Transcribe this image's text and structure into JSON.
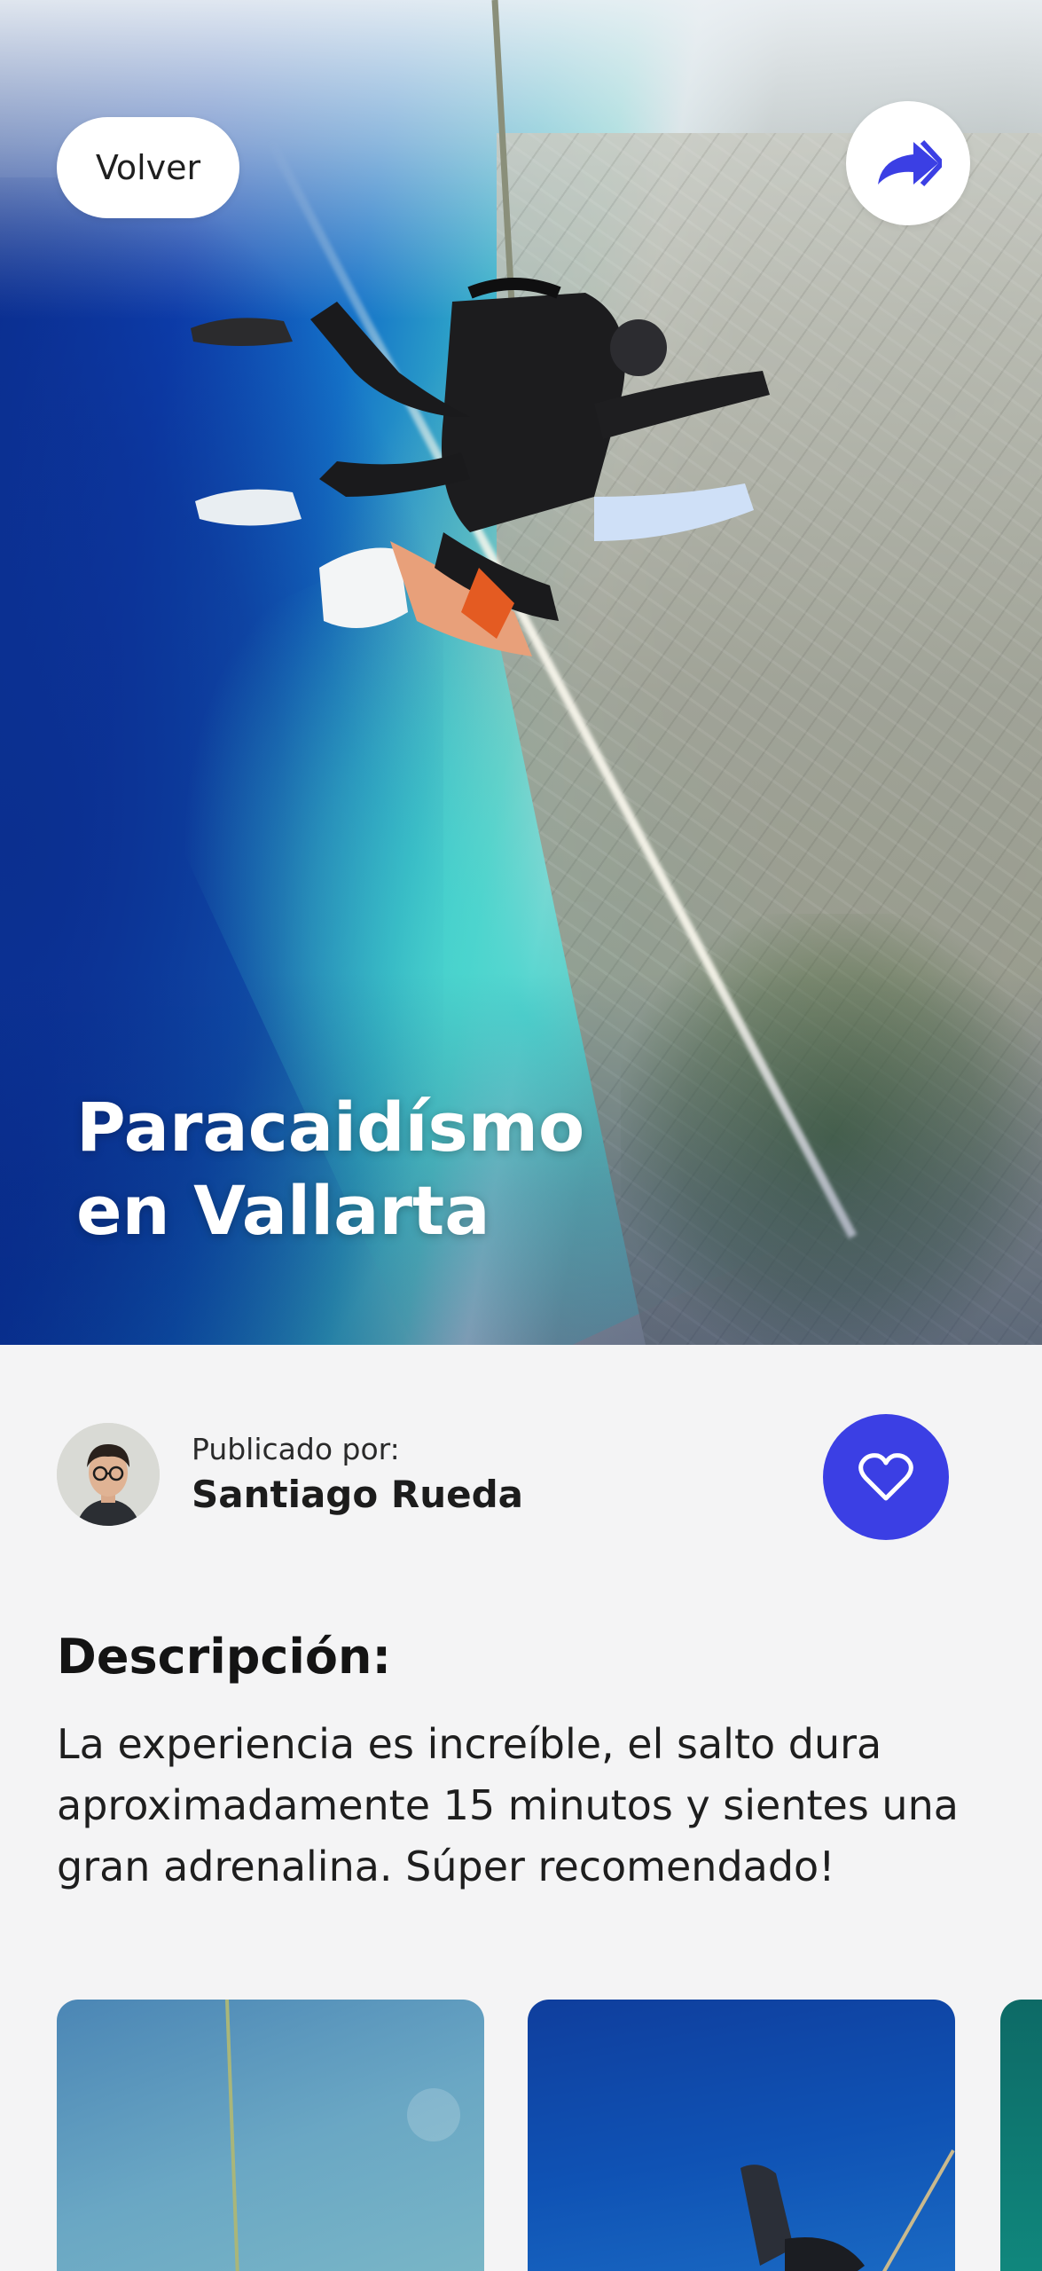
{
  "header": {
    "back_label": "Volver",
    "share_icon": "share-forward-icon"
  },
  "hero": {
    "title_line1": "Paracaidísmo",
    "title_line2": "en Vallarta"
  },
  "author": {
    "posted_label": "Publicado por:",
    "name": "Santiago Rueda",
    "like_icon": "heart-icon"
  },
  "description": {
    "title": "Descripción:",
    "text": "La experiencia es increíble, el salto dura aproximadamente 15 minutos y sientes una gran adrenalina. Súper recomendado!"
  },
  "gallery": {
    "items": [
      {
        "thumbnail": "skydiving-photo-1"
      },
      {
        "thumbnail": "skydiving-photo-2"
      },
      {
        "thumbnail": "skydiving-photo-3"
      }
    ]
  },
  "colors": {
    "accent": "#3b3fe4",
    "background": "#f4f4f5",
    "text": "#1c1c1c"
  }
}
